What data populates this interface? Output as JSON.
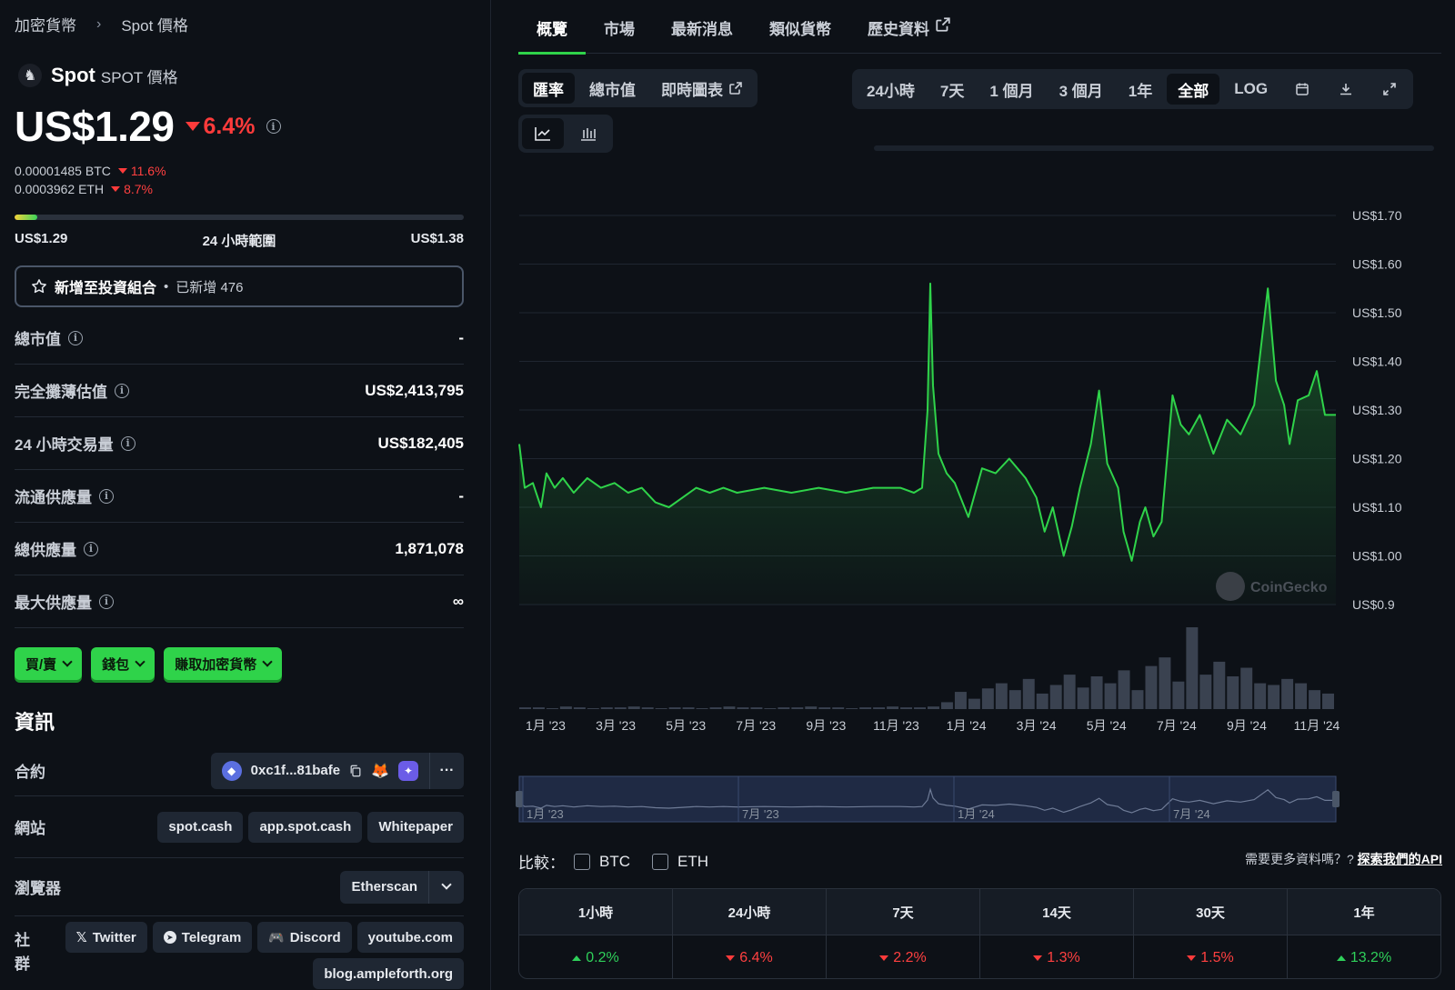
{
  "breadcrumb": {
    "root": "加密貨幣",
    "current": "Spot 價格"
  },
  "coin": {
    "name": "Spot",
    "symbol": "SPOT 價格"
  },
  "price": {
    "value": "US$1.29",
    "change": "6.4%",
    "btc": "0.00001485 BTC",
    "btc_change": "11.6%",
    "eth": "0.0003962 ETH",
    "eth_change": "8.7%"
  },
  "range": {
    "low": "US$1.29",
    "label": "24 小時範圍",
    "high": "US$1.38",
    "fill": 0.05
  },
  "portfolio": {
    "label": "新增至投資組合",
    "added": "已新增 476"
  },
  "stats": [
    {
      "label": "總市值",
      "value": "-"
    },
    {
      "label": "完全攤薄估值",
      "value": "US$2,413,795"
    },
    {
      "label": "24 小時交易量",
      "value": "US$182,405"
    },
    {
      "label": "流通供應量",
      "value": "-"
    },
    {
      "label": "總供應量",
      "value": "1,871,078"
    },
    {
      "label": "最大供應量",
      "value": "∞"
    }
  ],
  "actions": {
    "buy": "買/賣",
    "wallet": "錢包",
    "earn": "賺取加密貨幣"
  },
  "info": {
    "title": "資訊",
    "contract_label": "合約",
    "contract": "0xc1f...81bafe",
    "website_label": "網站",
    "sites": [
      "spot.cash",
      "app.spot.cash",
      "Whitepaper"
    ],
    "explorer_label": "瀏覽器",
    "explorer": "Etherscan",
    "social_label": "社群",
    "socials": [
      "Twitter",
      "Telegram",
      "Discord",
      "youtube.com",
      "blog.ampleforth.org"
    ]
  },
  "tabs": [
    "概覽",
    "市場",
    "最新消息",
    "類似貨幣",
    "歷史資料"
  ],
  "chart_modes": [
    "匯率",
    "總市值",
    "即時圖表"
  ],
  "ranges": [
    "24小時",
    "7天",
    "1 個月",
    "3 個月",
    "1年",
    "全部",
    "LOG"
  ],
  "watermark": "CoinGecko",
  "compare": {
    "label": "比較：",
    "btc": "BTC",
    "eth": "ETH"
  },
  "api": {
    "text": "需要更多資料嗎？?",
    "link": "探索我們的API"
  },
  "performance": {
    "headers": [
      "1小時",
      "24小時",
      "7天",
      "14天",
      "30天",
      "1年"
    ],
    "values": [
      "0.2%",
      "6.4%",
      "2.2%",
      "1.3%",
      "1.5%",
      "13.2%"
    ],
    "direction": [
      "up",
      "down",
      "down",
      "down",
      "down",
      "up"
    ]
  },
  "chart_data": {
    "type": "area",
    "y_ticks": [
      "US$1.70",
      "US$1.60",
      "US$1.50",
      "US$1.40",
      "US$1.30",
      "US$1.20",
      "US$1.10",
      "US$1.00",
      "US$0.9"
    ],
    "ylim": [
      0.9,
      1.7
    ],
    "x_ticks": [
      "1月 '23",
      "3月 '23",
      "5月 '23",
      "7月 '23",
      "9月 '23",
      "11月 '23",
      "1月 '24",
      "3月 '24",
      "5月 '24",
      "7月 '24",
      "9月 '24",
      "11月 '24"
    ],
    "navigator_ticks": [
      "1月 '23",
      "7月 '23",
      "1月 '24",
      "7月 '24"
    ],
    "series": [
      {
        "color": "#2fd34a",
        "x": [
          0,
          0.2,
          0.5,
          0.8,
          1.0,
          1.3,
          1.6,
          2.0,
          2.5,
          3.0,
          3.5,
          4.0,
          4.5,
          5.0,
          5.5,
          6.0,
          6.5,
          7.0,
          7.5,
          8.0,
          9.0,
          10.0,
          11.0,
          12.0,
          13.0,
          14.0,
          14.5,
          14.8,
          15.0,
          15.1,
          15.2,
          15.4,
          15.7,
          16.0,
          16.5,
          17.0,
          17.5,
          18.0,
          18.3,
          18.6,
          19.0,
          19.3,
          19.6,
          20.0,
          20.3,
          20.6,
          21.0,
          21.3,
          21.6,
          22.0,
          22.2,
          22.5,
          22.8,
          23.0,
          23.3,
          23.6,
          24.0,
          24.3,
          24.6,
          25.0,
          25.5,
          26.0,
          26.5,
          27.0,
          27.5,
          27.8,
          28.1,
          28.3,
          28.6,
          29.0,
          29.3,
          29.6,
          30.0
        ],
        "y": [
          1.23,
          1.14,
          1.15,
          1.1,
          1.17,
          1.14,
          1.16,
          1.13,
          1.16,
          1.14,
          1.15,
          1.13,
          1.14,
          1.11,
          1.1,
          1.12,
          1.14,
          1.13,
          1.14,
          1.13,
          1.14,
          1.13,
          1.14,
          1.13,
          1.14,
          1.14,
          1.13,
          1.14,
          1.3,
          1.56,
          1.35,
          1.21,
          1.17,
          1.15,
          1.08,
          1.18,
          1.17,
          1.2,
          1.18,
          1.16,
          1.12,
          1.05,
          1.1,
          1.0,
          1.06,
          1.14,
          1.23,
          1.34,
          1.19,
          1.14,
          1.05,
          0.99,
          1.07,
          1.1,
          1.04,
          1.07,
          1.33,
          1.27,
          1.25,
          1.29,
          1.21,
          1.28,
          1.25,
          1.31,
          1.55,
          1.36,
          1.31,
          1.23,
          1.32,
          1.33,
          1.38,
          1.29,
          1.29
        ]
      }
    ],
    "volume": [
      2,
      2,
      1,
      3,
      2,
      1,
      2,
      2,
      3,
      2,
      1,
      2,
      2,
      1,
      2,
      3,
      2,
      2,
      1,
      2,
      2,
      3,
      2,
      2,
      1,
      2,
      2,
      3,
      2,
      2,
      3,
      8,
      20,
      12,
      24,
      30,
      22,
      35,
      18,
      28,
      40,
      25,
      38,
      30,
      45,
      22,
      50,
      60,
      32,
      95,
      40,
      55,
      38,
      48,
      30,
      28,
      35,
      30,
      22,
      18
    ]
  }
}
